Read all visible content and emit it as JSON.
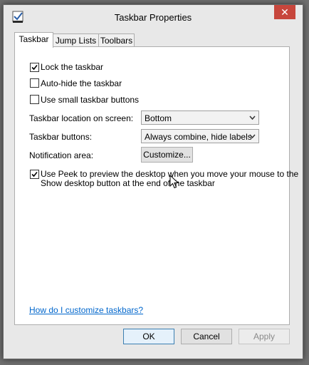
{
  "window": {
    "title": "Taskbar Properties",
    "close_label": "✕"
  },
  "tabs": [
    {
      "label": "Taskbar",
      "active": true
    },
    {
      "label": "Jump Lists",
      "active": false
    },
    {
      "label": "Toolbars",
      "active": false
    }
  ],
  "options": {
    "lock_taskbar": {
      "label": "Lock the taskbar",
      "checked": true
    },
    "auto_hide": {
      "label": "Auto-hide the taskbar",
      "checked": false
    },
    "small_buttons": {
      "label": "Use small taskbar buttons",
      "checked": false
    },
    "location": {
      "label": "Taskbar location on screen:",
      "value": "Bottom"
    },
    "buttons": {
      "label": "Taskbar buttons:",
      "value": "Always combine, hide labels"
    },
    "notification": {
      "label": "Notification area:",
      "button_label": "Customize..."
    },
    "peek": {
      "label_line1": "Use Peek to preview the desktop when you move your mouse to the",
      "label_line2": "Show desktop button at the end of the taskbar",
      "checked": true
    }
  },
  "help_link": "How do I customize taskbars?",
  "footer": {
    "ok_label": "OK",
    "cancel_label": "Cancel",
    "apply_label": "Apply"
  }
}
